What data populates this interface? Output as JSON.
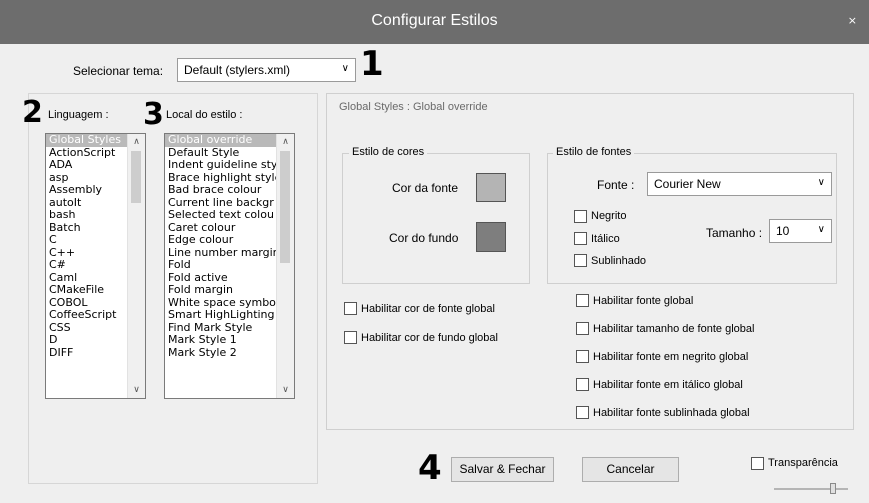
{
  "window": {
    "title": "Configurar Estilos",
    "close_label": "×"
  },
  "theme": {
    "label": "Selecionar tema:",
    "value": "Default (stylers.xml)"
  },
  "markers": [
    "1",
    "2",
    "3",
    "4"
  ],
  "language": {
    "label": "Linguagem :",
    "items": [
      "Global Styles",
      "ActionScript",
      "ADA",
      "asp",
      "Assembly",
      "autoIt",
      "bash",
      "Batch",
      "C",
      "C++",
      "C#",
      "Caml",
      "CMakeFile",
      "COBOL",
      "CoffeeScript",
      "CSS",
      "D",
      "DIFF"
    ],
    "selected_index": 0
  },
  "style": {
    "label": "Local do estilo :",
    "items": [
      "Global override",
      "Default Style",
      "Indent guideline sty",
      "Brace highlight style",
      "Bad brace colour",
      "Current line backgr",
      "Selected text colou",
      "Caret colour",
      "Edge colour",
      "Line number margin",
      "Fold",
      "Fold active",
      "Fold margin",
      "White space symbo",
      "Smart HighLighting",
      "Find Mark Style",
      "Mark Style 1",
      "Mark Style 2"
    ],
    "selected_index": 0
  },
  "panel": {
    "title": "Global Styles : Global override",
    "colors": {
      "legend": "Estilo de cores",
      "fg_label": "Cor da fonte",
      "bg_label": "Cor do fundo",
      "fg_color": "#b4b4b4",
      "bg_color": "#7e7e7e"
    },
    "fonts": {
      "legend": "Estilo de fontes",
      "font_label": "Fonte :",
      "font_value": "Courier New",
      "bold": "Negrito",
      "italic": "Itálico",
      "underline": "Sublinhado",
      "size_label": "Tamanho :",
      "size_value": "10"
    },
    "global_left": [
      "Habilitar cor de fonte global",
      "Habilitar cor de fundo global"
    ],
    "global_right": [
      "Habilitar fonte global",
      "Habilitar tamanho de fonte global",
      "Habilitar fonte em negrito global",
      "Habilitar fonte em itálico global",
      "Habilitar fonte sublinhada global"
    ]
  },
  "buttons": {
    "save": "Salvar & Fechar",
    "cancel": "Cancelar"
  },
  "transparency": {
    "label": "Transparência",
    "level": 0.8
  }
}
